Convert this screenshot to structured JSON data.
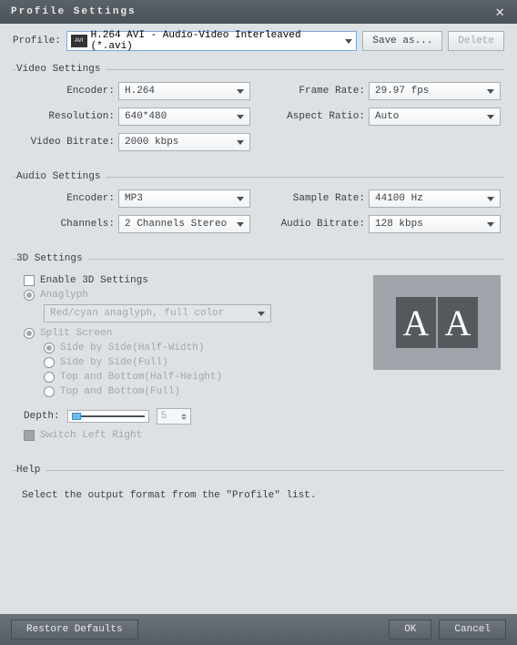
{
  "title": "Profile Settings",
  "profile": {
    "label": "Profile:",
    "value": "H.264 AVI - Audio-Video Interleaved (*.avi)",
    "save_as": "Save as...",
    "delete": "Delete"
  },
  "video": {
    "legend": "Video Settings",
    "encoder_label": "Encoder:",
    "encoder": "H.264",
    "resolution_label": "Resolution:",
    "resolution": "640*480",
    "bitrate_label": "Video Bitrate:",
    "bitrate": "2000 kbps",
    "framerate_label": "Frame Rate:",
    "framerate": "29.97 fps",
    "aspect_label": "Aspect Ratio:",
    "aspect": "Auto"
  },
  "audio": {
    "legend": "Audio Settings",
    "encoder_label": "Encoder:",
    "encoder": "MP3",
    "channels_label": "Channels:",
    "channels": "2 Channels Stereo",
    "samplerate_label": "Sample Rate:",
    "samplerate": "44100 Hz",
    "bitrate_label": "Audio Bitrate:",
    "bitrate": "128 kbps"
  },
  "threed": {
    "legend": "3D Settings",
    "enable": "Enable 3D Settings",
    "anaglyph": "Anaglyph",
    "anaglyph_mode": "Red/cyan anaglyph, full color",
    "split": "Split Screen",
    "sbs_half": "Side by Side(Half-Width)",
    "sbs_full": "Side by Side(Full)",
    "tb_half": "Top and Bottom(Half-Height)",
    "tb_full": "Top and Bottom(Full)",
    "depth_label": "Depth:",
    "depth_value": "5",
    "switch_lr": "Switch Left Right",
    "preview_glyph": "A"
  },
  "help": {
    "legend": "Help",
    "text": "Select the output format from the \"Profile\" list."
  },
  "footer": {
    "restore": "Restore Defaults",
    "ok": "OK",
    "cancel": "Cancel"
  }
}
